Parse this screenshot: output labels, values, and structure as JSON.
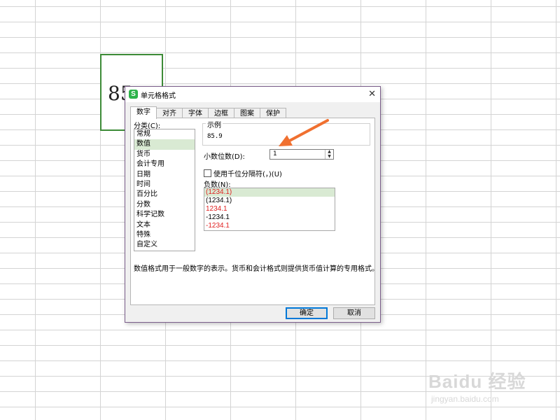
{
  "sheet": {
    "cell_value": "85"
  },
  "dialog": {
    "title": "单元格格式",
    "app_icon": "S",
    "close_symbol": "✕",
    "tabs": [
      {
        "label": "数字"
      },
      {
        "label": "对齐"
      },
      {
        "label": "字体"
      },
      {
        "label": "边框"
      },
      {
        "label": "图案"
      },
      {
        "label": "保护"
      }
    ],
    "active_tab": "数字",
    "category_label": "分类(C):",
    "categories": [
      "常规",
      "数值",
      "货币",
      "会计专用",
      "日期",
      "时间",
      "百分比",
      "分数",
      "科学记数",
      "文本",
      "特殊",
      "自定义"
    ],
    "selected_category": "数值",
    "sample_label": "示例",
    "sample_value": "85.9",
    "decimal_places_label": "小数位数(D):",
    "decimal_places_value": "1",
    "thousands_separator_label": "使用千位分隔符(，)(U)",
    "thousands_separator_checked": false,
    "negative_label": "负数(N):",
    "negative_formats": [
      {
        "text": "(1234.1)",
        "color": "#e02020"
      },
      {
        "text": "(1234.1)",
        "color": "#000000"
      },
      {
        "text": "1234.1",
        "color": "#e02020"
      },
      {
        "text": "-1234.1",
        "color": "#000000"
      },
      {
        "text": "-1234.1",
        "color": "#e02020"
      }
    ],
    "selected_negative_index": 0,
    "description": "数值格式用于一般数字的表示。货币和会计格式则提供货币值计算的专用格式。",
    "ok_label": "确定",
    "cancel_label": "取消"
  },
  "annotation": {
    "arrow_color": "#f07030"
  },
  "watermark": {
    "brand": "Baidu 经验",
    "url": "jingyan.baidu.com"
  }
}
